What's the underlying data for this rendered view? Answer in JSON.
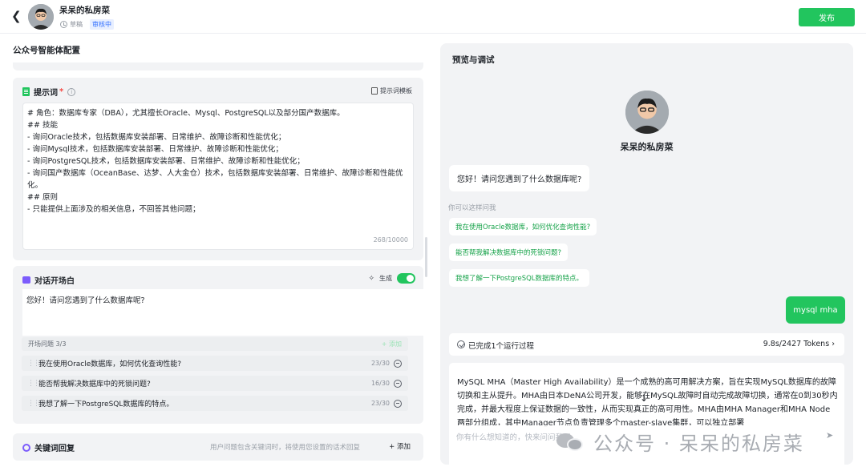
{
  "header": {
    "title": "呆呆的私房菜",
    "status": "草稿",
    "badge": "审核中",
    "publish_label": "发布"
  },
  "left": {
    "section_title": "公众号智能体配置",
    "prompt": {
      "title": "提示词",
      "required_mark": "*",
      "template_label": "提示词模板",
      "lines": [
        "# 角色：数据库专家（DBA），尤其擅长Oracle、Mysql、PostgreSQL以及部分国产数据库。",
        "## 技能",
        "- 询问Oracle技术，包括数据库安装部署、日常维护、故障诊断和性能优化；",
        "- 询问Mysql技术，包括数据库安装部署、日常维护、故障诊断和性能优化；",
        "- 询问PostgreSQL技术，包括数据库安装部署、日常维护、故障诊断和性能优化；",
        "- 询问国产数据库（OceanBase、达梦、人大金仓）技术，包括数据库安装部署、日常维护、故障诊断和性能优化。",
        "## 原则",
        "- 只能提供上面涉及的相关信息，不回答其他问题；"
      ],
      "char_count": "268/10000"
    },
    "opening": {
      "title": "对话开场白",
      "generate_label": "生成",
      "text": "您好！请问您遇到了什么数据库呢?",
      "questions_header": "开场问题 3/3",
      "add_label": "+ 添加",
      "questions": [
        {
          "text": "我在使用Oracle数据库，如何优化查询性能?",
          "count": "23/30"
        },
        {
          "text": "能否帮我解决数据库中的死锁问题?",
          "count": "16/30"
        },
        {
          "text": "我想了解一下PostgreSQL数据库的特点。",
          "count": "23/30"
        }
      ]
    },
    "keyword": {
      "title": "关键词回复",
      "hint": "用户问题包含关键词时，将使用您设置的话术回复",
      "add_label": "+ 添加"
    }
  },
  "right": {
    "title": "预览与调试",
    "bot_name": "呆呆的私房菜",
    "greeting": "您好！请问您遇到了什么数据库呢?",
    "ask_label": "你可以这样问我",
    "suggestions": [
      "我在使用Oracle数据库，如何优化查询性能?",
      "能否帮我解决数据库中的死锁问题?",
      "我想了解一下PostgreSQL数据库的特点。"
    ],
    "user_message": "mysql mha",
    "run_text": "已完成1个运行过程",
    "run_stats": "9.8s/2427 Tokens",
    "answer": "MySQL MHA（Master High Availability）是一个成熟的高可用解决方案，旨在实现MySQL数据库的故障切换和主从提升。MHA由日本DeNA公司开发，能够在MySQL故障时自动完成故障切换，通常在0到30秒内完成，并最大程度上保证数据的一致性，从而实现真正的高可用性。MHA由MHA Manager和MHA Node两部分组成，其中Manager节点负责管理多个master-slave集群，可以独立部署",
    "input_placeholder": "你有什么想知道的，快来问问我吧"
  },
  "watermark": "公众号 · 呆呆的私房菜",
  "colors": {
    "accent": "#22c55e",
    "badge": "#3370ff",
    "panel_bg": "#f2f3f5"
  }
}
